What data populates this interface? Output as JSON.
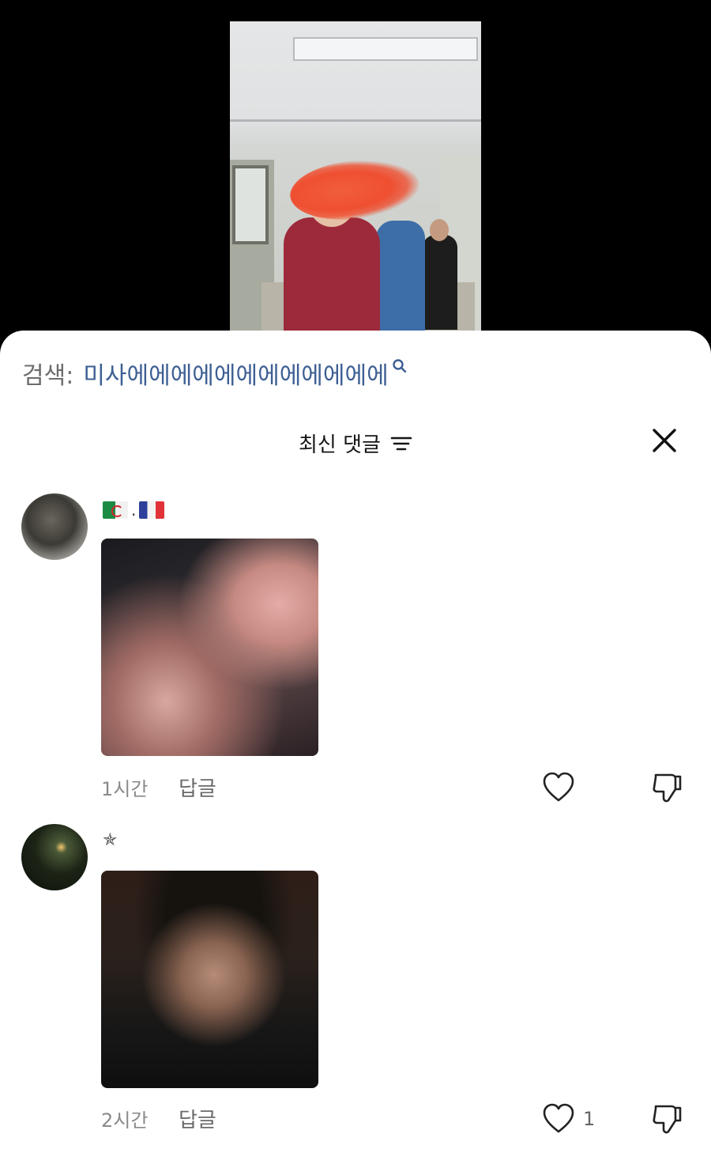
{
  "search": {
    "prefix": "검색:",
    "query": "미사에에에에에에에에에에에에"
  },
  "sheet": {
    "title": "최신 댓글"
  },
  "comments": [
    {
      "name": "",
      "flags": [
        "Algeria",
        "France"
      ],
      "time": "1시간",
      "reply_label": "답글",
      "like_count": ""
    },
    {
      "name": "✯",
      "time": "2시간",
      "reply_label": "답글",
      "like_count": "1"
    }
  ],
  "icons": {
    "sort": "sort-lines-icon",
    "close": "close-x-icon",
    "search": "search-icon",
    "like": "heart-icon",
    "dislike": "thumbs-down-icon"
  },
  "colors": {
    "search_query": "#3d5f93",
    "sheet_bg": "#ffffff",
    "backdrop": "#000000"
  }
}
